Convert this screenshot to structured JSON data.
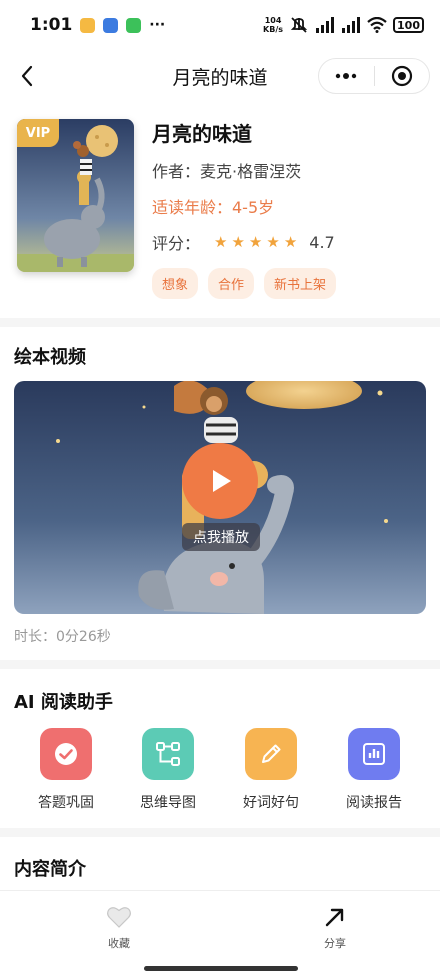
{
  "status_bar": {
    "time": "1:01",
    "network_speed_value": "104",
    "network_speed_unit": "KB/s",
    "battery": "100"
  },
  "nav": {
    "title": "月亮的味道"
  },
  "book": {
    "vip_badge": "VIP",
    "title": "月亮的味道",
    "author": "作者：麦克·格雷涅茨",
    "age": "适读年龄：4-5岁",
    "rating_label": "评分：",
    "rating_value": "4.7",
    "rating_stars": 5,
    "tags": [
      "想象",
      "合作",
      "新书上架"
    ]
  },
  "video_section": {
    "title": "绘本视频",
    "play_label": "点我播放",
    "duration": "时长：0分26秒"
  },
  "ai_section": {
    "title": "AI 阅读助手",
    "items": [
      {
        "label": "答题巩固",
        "color": "#ef6f6f",
        "icon": "check-icon"
      },
      {
        "label": "思维导图",
        "color": "#5ccbb5",
        "icon": "mindmap-icon"
      },
      {
        "label": "好词好句",
        "color": "#f7b452",
        "icon": "pencil-icon"
      },
      {
        "label": "阅读报告",
        "color": "#6f7cf0",
        "icon": "chart-icon"
      }
    ]
  },
  "intro_section": {
    "title": "内容简介"
  },
  "bottom_bar": {
    "favorite_label": "收藏",
    "share_label": "分享"
  },
  "colors": {
    "accent": "#ea7c4a",
    "vip": "#e9b44c",
    "star": "#f1a33c"
  }
}
